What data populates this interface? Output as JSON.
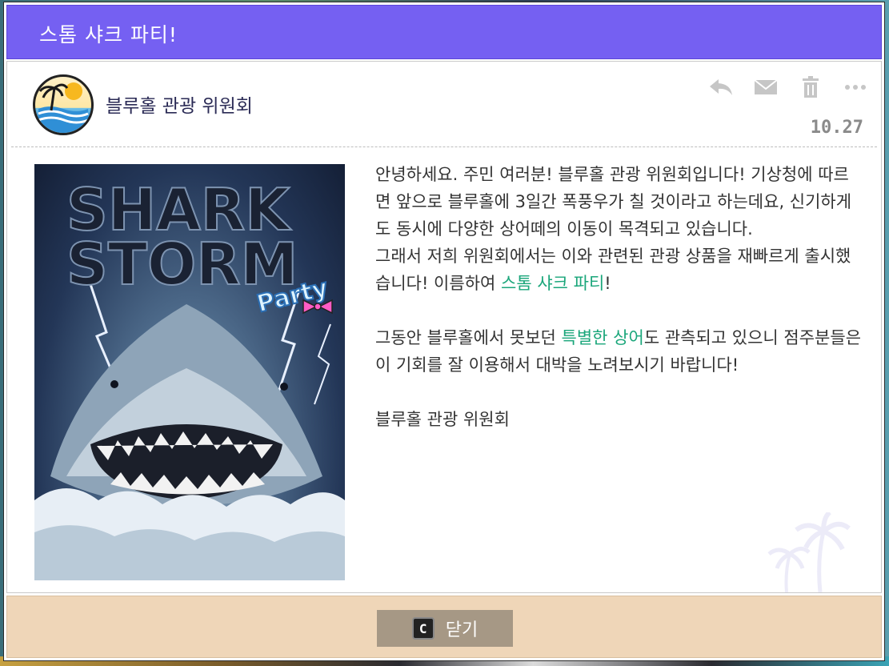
{
  "window": {
    "title": "스톰 샤크 파티!"
  },
  "message": {
    "sender": "블루홀 관광 위원회",
    "date": "10.27",
    "actions": [
      {
        "icon": "reply-icon"
      },
      {
        "icon": "mail-icon"
      },
      {
        "icon": "trash-icon"
      },
      {
        "icon": "more-icon"
      }
    ],
    "poster": {
      "title_line1": "SHARK",
      "title_line2": "STORM",
      "tag": "Party"
    },
    "body": {
      "p1_part1": "안녕하세요. 주민 여러분! 블루홀 관광 위원회입니다! 기상청에 따르면 앞으로 블루홀에 3일간 폭풍우가 칠 것이라고 하는데요, 신기하게도 동시에 다양한 상어떼의 이동이 목격되고 있습니다.\n그래서 저희 위원회에서는 이와 관련된 관광 상품을 재빠르게 출시했습니다! 이름하여 ",
      "p1_highlight": "스톰 샤크 파티",
      "p1_part2": "!",
      "p2_part1": "그동안 블루홀에서 못보던 ",
      "p2_highlight": "특별한 상어",
      "p2_part2": "도 관측되고 있으니 점주분들은 이 기회를 잘 이용해서 대박을 노려보시기 바랍니다!",
      "signature": "블루홀 관광 위원회"
    },
    "highlight_color": "#1aa67a"
  },
  "footer": {
    "close_key": "C",
    "close_label": "닫기"
  },
  "colors": {
    "titlebar": "#7560f2",
    "footer": "#efd6b8",
    "close_button": "#a69885"
  }
}
